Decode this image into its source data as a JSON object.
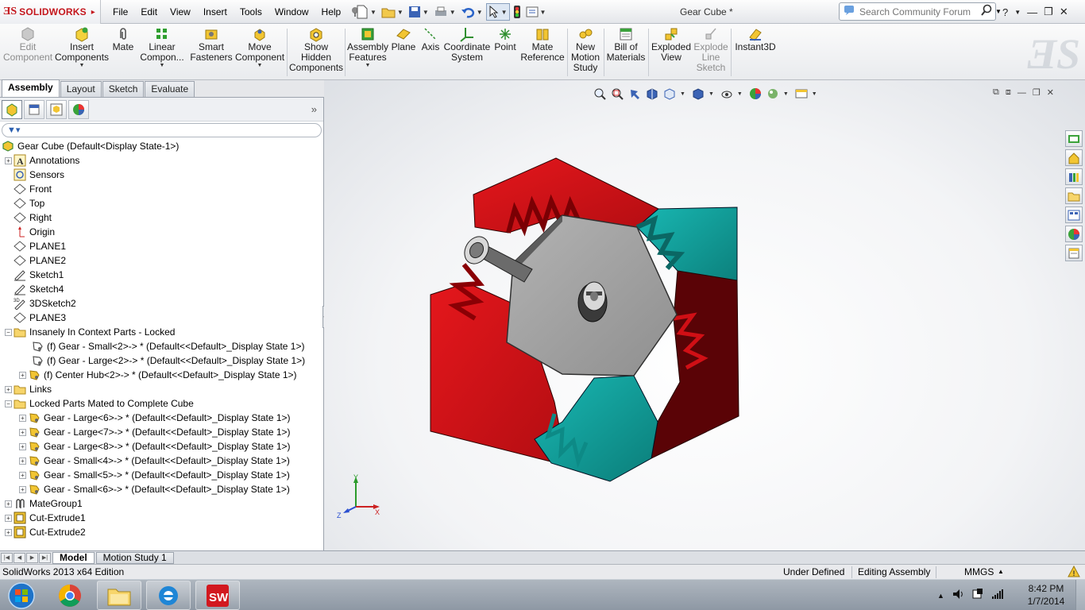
{
  "app": {
    "logo": "SOLIDWORKS",
    "doc_title": "Gear Cube *"
  },
  "menu": [
    "File",
    "Edit",
    "View",
    "Insert",
    "Tools",
    "Window",
    "Help"
  ],
  "search": {
    "placeholder": "Search Community Forum"
  },
  "toolbar": {
    "edit_component": "Edit\nComponent",
    "insert_components": "Insert\nComponents",
    "mate": "Mate",
    "linear_component": "Linear\nCompon...",
    "smart_fasteners": "Smart\nFasteners",
    "move_component": "Move\nComponent",
    "show_hidden": "Show\nHidden\nComponents",
    "assembly_features": "Assembly\nFeatures",
    "plane": "Plane",
    "axis": "Axis",
    "coordinate_system": "Coordinate\nSystem",
    "point": "Point",
    "mate_reference": "Mate\nReference",
    "new_motion_study": "New\nMotion\nStudy",
    "bill_of_materials": "Bill of\nMaterials",
    "exploded_view": "Exploded\nView",
    "explode_line_sketch": "Explode\nLine\nSketch",
    "instant3d": "Instant3D"
  },
  "cm_tabs": [
    "Assembly",
    "Layout",
    "Sketch",
    "Evaluate"
  ],
  "tree": {
    "root": "Gear Cube  (Default<Display State-1>)",
    "items": [
      {
        "label": "Annotations"
      },
      {
        "label": "Sensors"
      },
      {
        "label": "Front"
      },
      {
        "label": "Top"
      },
      {
        "label": "Right"
      },
      {
        "label": "Origin"
      },
      {
        "label": "PLANE1"
      },
      {
        "label": "PLANE2"
      },
      {
        "label": "Sketch1"
      },
      {
        "label": "Sketch4"
      },
      {
        "label": "3DSketch2"
      },
      {
        "label": "PLANE3"
      },
      {
        "label": "Insanely In Context Parts - Locked"
      },
      {
        "label": "(f) Gear - Small<2>-> * (Default<<Default>_Display State 1>)"
      },
      {
        "label": "(f) Gear - Large<2>-> * (Default<<Default>_Display State 1>)"
      },
      {
        "label": "(f) Center Hub<2>-> * (Default<<Default>_Display State 1>)"
      },
      {
        "label": "Links"
      },
      {
        "label": "Locked Parts Mated to Complete Cube"
      },
      {
        "label": "Gear - Large<6>-> * (Default<<Default>_Display State 1>)"
      },
      {
        "label": "Gear - Large<7>-> * (Default<<Default>_Display State 1>)"
      },
      {
        "label": "Gear - Large<8>-> * (Default<<Default>_Display State 1>)"
      },
      {
        "label": "Gear - Small<4>-> * (Default<<Default>_Display State 1>)"
      },
      {
        "label": "Gear - Small<5>-> * (Default<<Default>_Display State 1>)"
      },
      {
        "label": "Gear - Small<6>-> * (Default<<Default>_Display State 1>)"
      },
      {
        "label": "MateGroup1"
      },
      {
        "label": "Cut-Extrude1"
      },
      {
        "label": "Cut-Extrude2"
      }
    ]
  },
  "triad": {
    "y": "Y",
    "x": "X",
    "z": "Z"
  },
  "bottom_tabs": [
    "Model",
    "Motion Study 1"
  ],
  "status": {
    "edition": "SolidWorks 2013 x64 Edition",
    "defined": "Under Defined",
    "mode": "Editing Assembly",
    "units": "MMGS",
    "units_arrow": "▲"
  },
  "clock": {
    "time": "8:42 PM",
    "date": "1/7/2014"
  },
  "colors": {
    "gear_red": "#d91319",
    "gear_teal": "#12a7a3",
    "hub_gray": "#a6a6a6",
    "accent": "#c4161c"
  }
}
